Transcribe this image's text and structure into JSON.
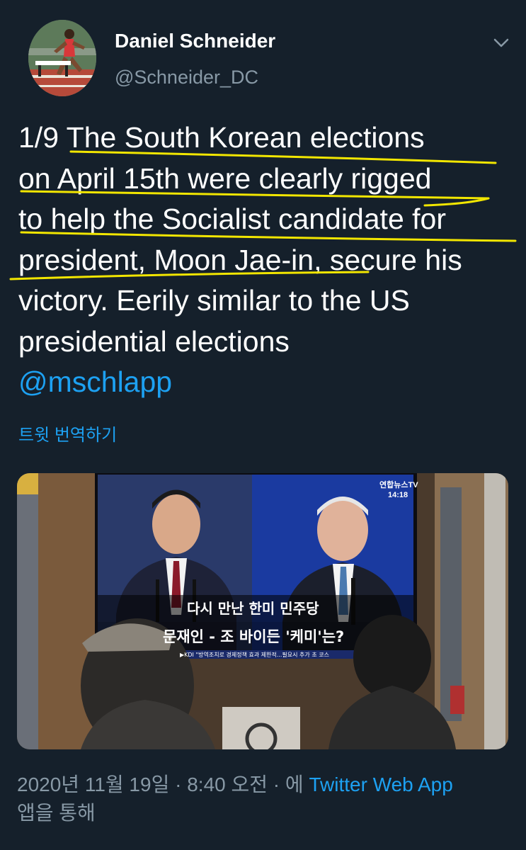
{
  "author": {
    "name": "Daniel Schneider",
    "handle": "@Schneider_DC"
  },
  "tweet": {
    "lines": [
      "1/9 The South Korean elections",
      "on April 15th were clearly rigged",
      "to help the Socialist candidate for",
      "president, Moon Jae-in, secure his",
      "victory. Eerily similar to the US",
      "presidential elections"
    ],
    "mention": "@mschlapp",
    "translate_label": "트윗 번역하기"
  },
  "media": {
    "tv_channel": "연합뉴스TV",
    "tv_time": "14:18",
    "caption_top": "다시 만난 한미 민주당",
    "caption_bottom": "문재인 - 조 바이든 '케미'는?",
    "ticker": "▶KDI \"방역조치로 경제정책 효과 제한적...필요시 추가 초 코스"
  },
  "meta": {
    "timestamp": "2020년 11월 19일 · 8:40 오전 · 에 ",
    "app_name": "Twitter Web App",
    "via_suffix": "앱을 통해"
  },
  "colors": {
    "background": "#15202b",
    "accent": "#1da1f2",
    "secondary_text": "#8899a6",
    "highlight_underline": "#f2e600"
  },
  "icons": {
    "chevron": "chevron-down-icon"
  }
}
